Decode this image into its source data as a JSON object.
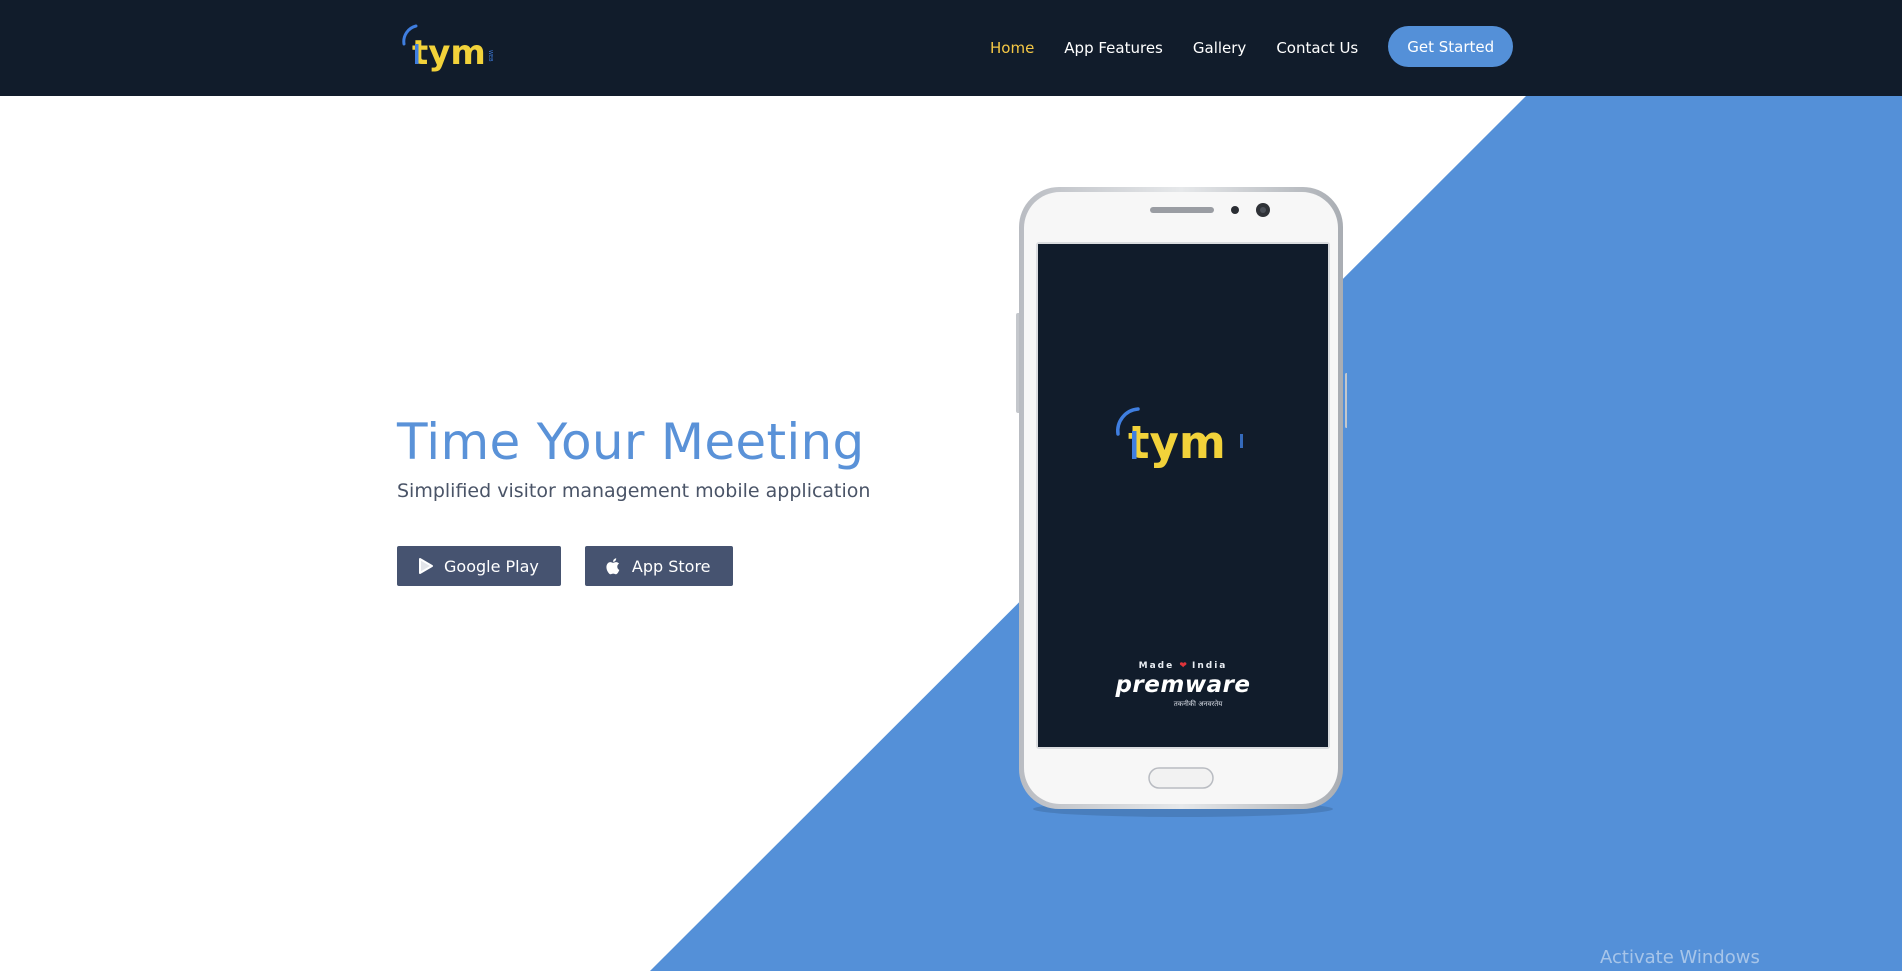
{
  "brand": {
    "logo_text": "tym",
    "logo_tag": "WEB"
  },
  "nav": {
    "items": [
      {
        "label": "Home",
        "active": true
      },
      {
        "label": "App Features",
        "active": false
      },
      {
        "label": "Gallery",
        "active": false
      },
      {
        "label": "Contact Us",
        "active": false
      }
    ],
    "cta_label": "Get Started"
  },
  "hero": {
    "title": "Time Your Meeting",
    "subtitle": "Simplified visitor management mobile application",
    "buttons": [
      {
        "label": "Google Play",
        "icon": "google-play-icon"
      },
      {
        "label": "App Store",
        "icon": "apple-icon"
      }
    ]
  },
  "phone": {
    "screen_logo_text": "tym",
    "made_in_prefix": "Made",
    "made_in_suffix": "India",
    "made_in_icon": "heart-icon",
    "company": "premware",
    "company_tagline": "तकनीकी अनवरतेय"
  },
  "system": {
    "watermark": "Activate Windows"
  },
  "colors": {
    "header_bg": "#111c2b",
    "accent_blue": "#5490d8",
    "nav_active": "#f5c845",
    "store_button_bg": "#465370",
    "logo_yellow": "#f2d23a",
    "logo_blue": "#3f7ee0"
  }
}
